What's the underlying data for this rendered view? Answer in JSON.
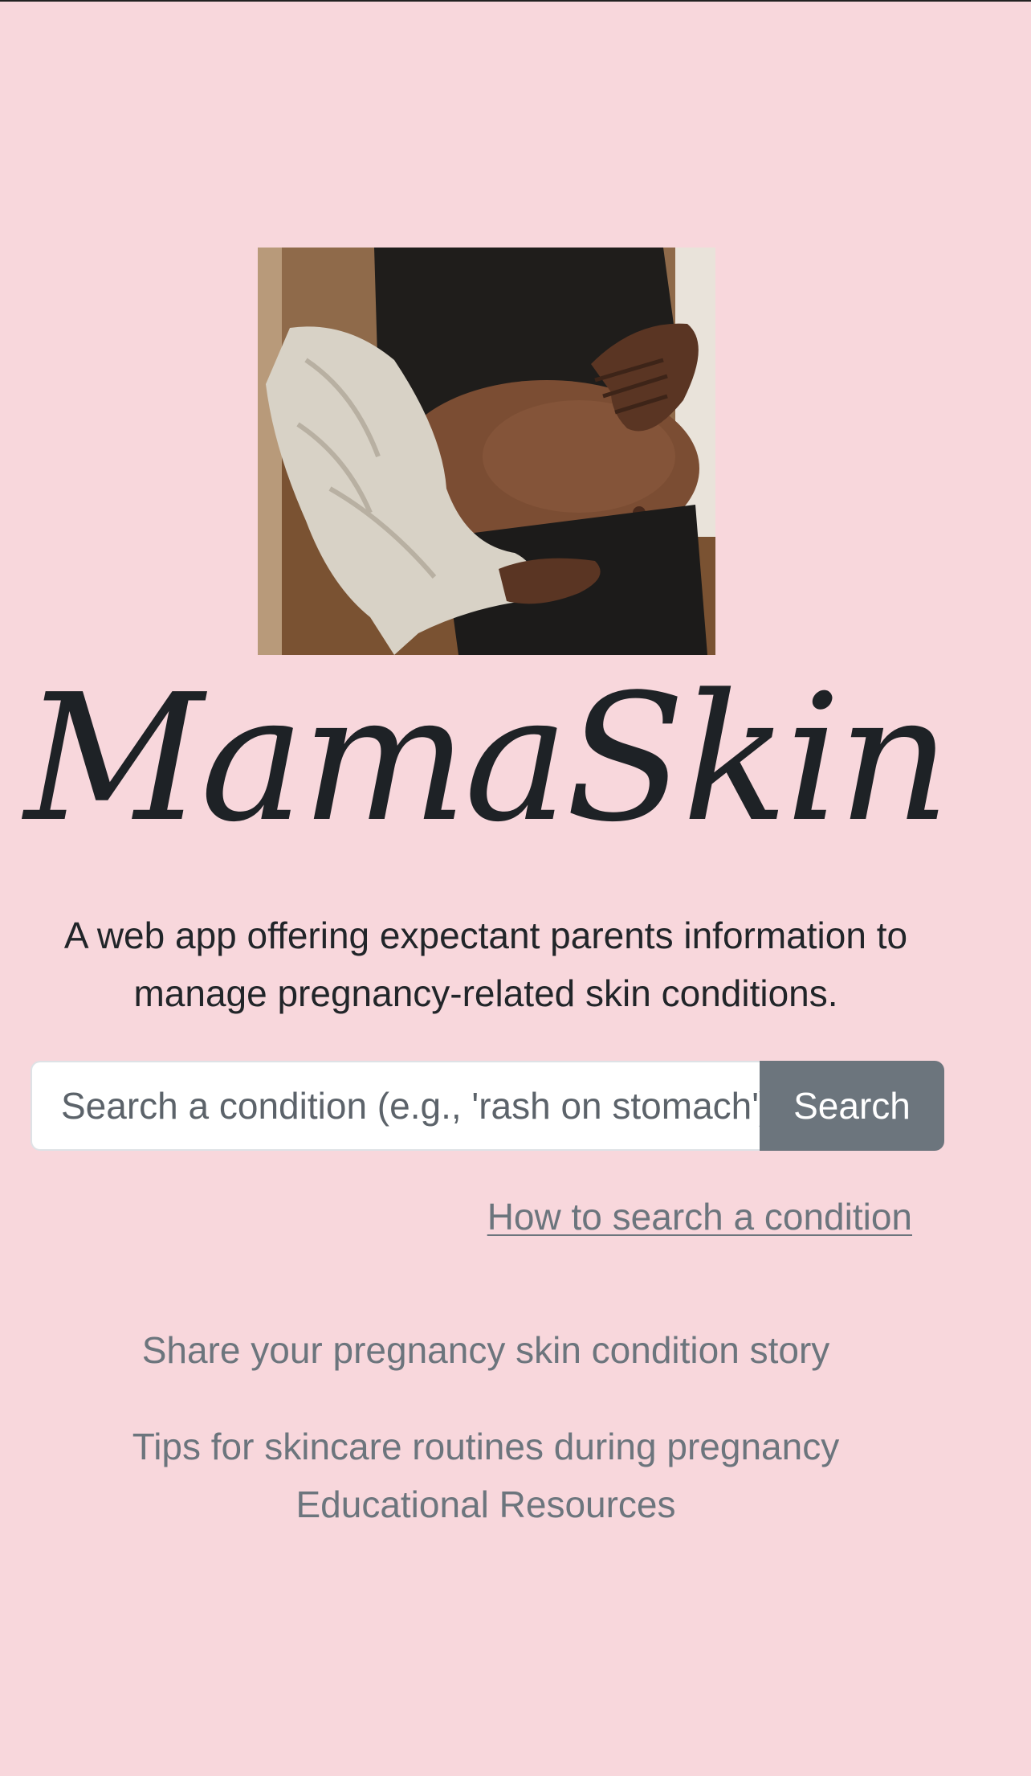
{
  "hero": {
    "image_alt": "Pregnant woman holding belly",
    "icon": "hero-photo"
  },
  "brand": {
    "title": "MamaSkin"
  },
  "tagline": {
    "line1": "A web app offering expectant parents information to",
    "line2": "manage pregnancy-related skin conditions."
  },
  "search": {
    "placeholder": "Search a condition (e.g., 'rash on stomach')",
    "value": "",
    "button_label": "Search"
  },
  "help_link": {
    "label": "How to search a condition"
  },
  "links": {
    "share_story": "Share your pregnancy skin condition story",
    "skincare_tips": "Tips for skincare routines during pregnancy",
    "educational_resources": "Educational Resources"
  },
  "colors": {
    "background": "#f8d7dc",
    "button": "#6c757d",
    "link": "#6c757d",
    "text": "#212529"
  }
}
